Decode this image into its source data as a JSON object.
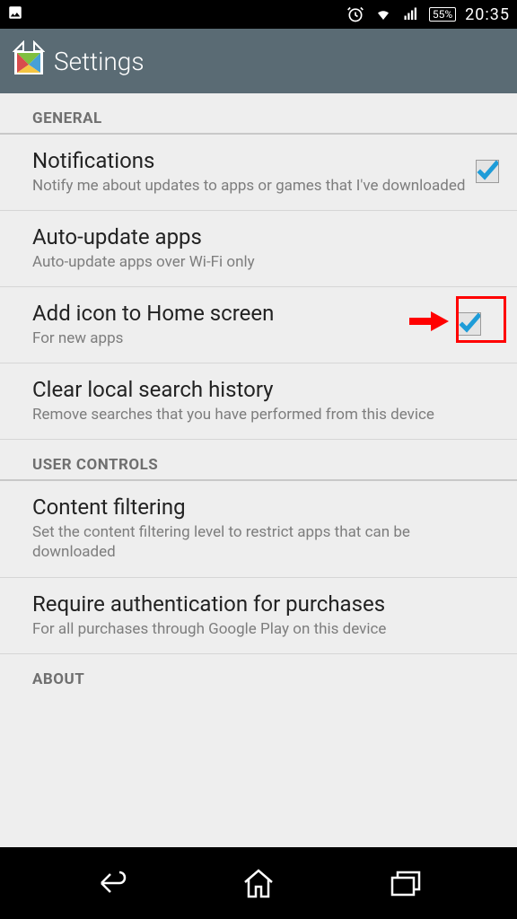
{
  "status": {
    "battery_percent": "55%",
    "time": "20:35"
  },
  "header": {
    "title": "Settings"
  },
  "sections": {
    "general": {
      "label": "GENERAL"
    },
    "user_controls": {
      "label": "USER CONTROLS"
    },
    "about": {
      "label": "ABOUT"
    }
  },
  "settings": {
    "notifications": {
      "title": "Notifications",
      "sub": "Notify me about updates to apps or games that I've downloaded",
      "checked": true
    },
    "auto_update": {
      "title": "Auto-update apps",
      "sub": "Auto-update apps over Wi-Fi only"
    },
    "add_icon": {
      "title": "Add icon to Home screen",
      "sub": "For new apps",
      "checked": true,
      "highlighted": true
    },
    "clear_search": {
      "title": "Clear local search history",
      "sub": "Remove searches that you have performed from this device"
    },
    "content_filtering": {
      "title": "Content filtering",
      "sub": "Set the content filtering level to restrict apps that can be downloaded"
    },
    "require_auth": {
      "title": "Require authentication for purchases",
      "sub": "For all purchases through Google Play on this device"
    }
  }
}
